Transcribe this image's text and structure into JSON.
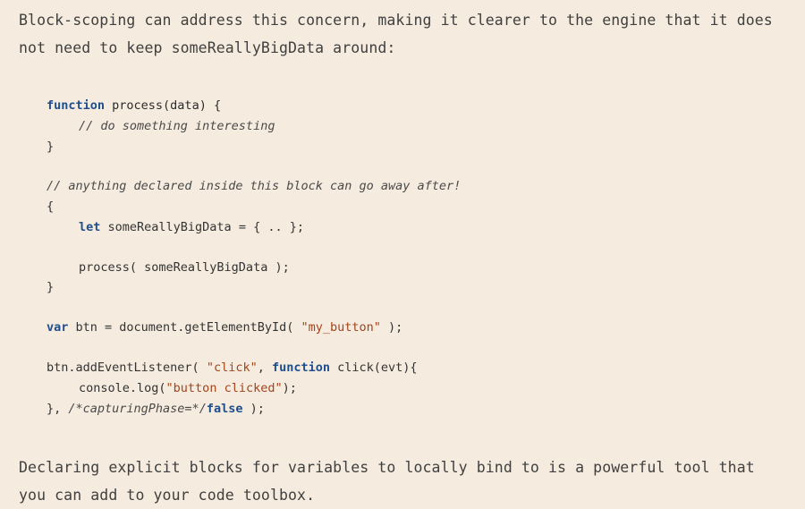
{
  "intro_paragraph": "Block-scoping can address this concern, making it clearer to the engine that it does not need to keep someReallyBigData around:",
  "code": {
    "line1": {
      "kw": "function",
      "rest": " process(data) {"
    },
    "line2": {
      "comment": "// do something interesting"
    },
    "line3": {
      "text": "}"
    },
    "line4": {
      "comment": "// anything declared inside this block can go away after!"
    },
    "line5": {
      "text": "{"
    },
    "line6": {
      "kw": "let",
      "rest": " someReallyBigData = { .. };"
    },
    "line7": {
      "text": "process( someReallyBigData );"
    },
    "line8": {
      "text": "}"
    },
    "line9": {
      "kw": "var",
      "mid": " btn = document.getElementById( ",
      "str": "\"my_button\"",
      "rest": " );"
    },
    "line10": {
      "pre": "btn.addEventListener( ",
      "str": "\"click\"",
      "comma": ", ",
      "kw": "function",
      "rest": " click(evt){"
    },
    "line11": {
      "pre": "console.log(",
      "str": "\"button clicked\"",
      "rest": ");"
    },
    "line12": {
      "pre": "}, ",
      "comment": "/*capturingPhase=*/",
      "kw": "false",
      "rest": " );"
    }
  },
  "outro_paragraph": "Declaring explicit blocks for variables to locally bind to is a powerful tool that you can add to your code toolbox."
}
